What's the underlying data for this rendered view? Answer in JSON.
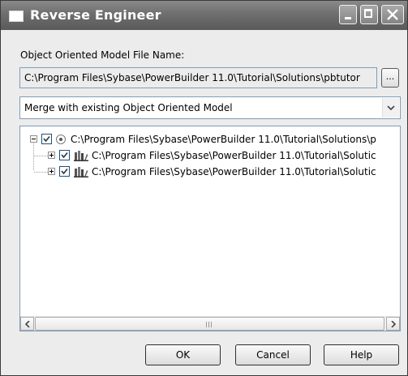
{
  "window": {
    "title": "Reverse Engineer"
  },
  "form": {
    "file_label": "Object Oriented Model File Name:",
    "file_value": "C:\\Program Files\\Sybase\\PowerBuilder 11.0\\Tutorial\\Solutions\\pbtutor",
    "browse_label": "...",
    "mode_selected": "Merge with existing Object Oriented Model"
  },
  "tree": {
    "root": {
      "label": "C:\\Program Files\\Sybase\\PowerBuilder 11.0\\Tutorial\\Solutions\\p",
      "checked": true,
      "expanded": true
    },
    "children": [
      {
        "label": "C:\\Program Files\\Sybase\\PowerBuilder 11.0\\Tutorial\\Solutic",
        "checked": true,
        "expanded": false
      },
      {
        "label": "C:\\Program Files\\Sybase\\PowerBuilder 11.0\\Tutorial\\Solutic",
        "checked": true,
        "expanded": false
      }
    ]
  },
  "buttons": {
    "ok": "OK",
    "cancel": "Cancel",
    "help": "Help"
  },
  "icons": [
    "window-icon",
    "minimize-icon",
    "maximize-icon",
    "close-icon",
    "dropdown-arrow-icon",
    "radio-icon",
    "library-icon",
    "checkbox-icon",
    "expand-icon",
    "collapse-icon",
    "scroll-left-icon",
    "scroll-right-icon"
  ],
  "colors": {
    "titlebar": "#6e6e6e",
    "field_border": "#7f9db9",
    "window_bg": "#ececec"
  }
}
